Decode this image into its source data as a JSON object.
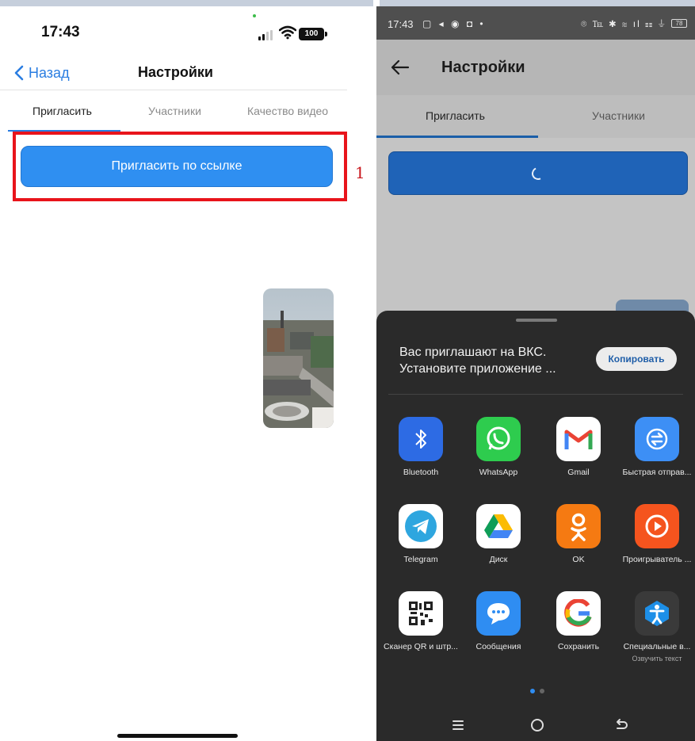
{
  "left": {
    "status": {
      "time": "17:43",
      "battery": "100"
    },
    "nav": {
      "back_label": "Назад",
      "title": "Настройки"
    },
    "tabs": [
      "Пригласить",
      "Участники",
      "Качество видео"
    ],
    "invite_button": "Пригласить по ссылке",
    "annotation_number": "1"
  },
  "right": {
    "status": {
      "time": "17:43",
      "left_icons": "▢ ◂ ◉ ◘  •",
      "right_icons": "⌾ ℡ ✱ ≋ ıl ☷ ⏚",
      "battery": "78"
    },
    "appbar": {
      "title": "Настройки"
    },
    "tabs": [
      "Пригласить",
      "Участники"
    ],
    "share": {
      "message_line1": "Вас приглашают на ВКС.",
      "message_line2": "Установите приложение ...",
      "copy_label": "Копировать",
      "apps": [
        {
          "label": "Bluetooth",
          "icon": "bluetooth-icon",
          "color": "#2d6be4"
        },
        {
          "label": "WhatsApp",
          "icon": "whatsapp-icon",
          "color": "#2ecc4e"
        },
        {
          "label": "Gmail",
          "icon": "gmail-icon",
          "color": "#ffffff"
        },
        {
          "label": "Быстрая отправ...",
          "icon": "quick-send-icon",
          "color": "#3d8ff5"
        },
        {
          "label": "Telegram",
          "icon": "telegram-icon",
          "color": "#ffffff"
        },
        {
          "label": "Диск",
          "icon": "drive-icon",
          "color": "#ffffff"
        },
        {
          "label": "OK",
          "icon": "ok-icon",
          "color": "#f57a12"
        },
        {
          "label": "Проигрыватель ...",
          "icon": "player-icon",
          "color": "#f5541e"
        },
        {
          "label": "Сканер QR и штр...",
          "icon": "qr-scanner-icon",
          "color": "#ffffff"
        },
        {
          "label": "Сообщения",
          "icon": "messages-icon",
          "color": "#2f8df2"
        },
        {
          "label": "Сохранить",
          "icon": "google-icon",
          "color": "#ffffff"
        },
        {
          "label": "Специальные в...",
          "sub": "Озвучить текст",
          "icon": "accessibility-icon",
          "color": "#3a3a3a"
        }
      ]
    }
  },
  "colors": {
    "ios_accent": "#2a7de1",
    "ios_button": "#2f8ff1",
    "highlight_red": "#e8141b",
    "android_button": "#1f63b7",
    "sheet_bg": "#2a2a2a"
  }
}
